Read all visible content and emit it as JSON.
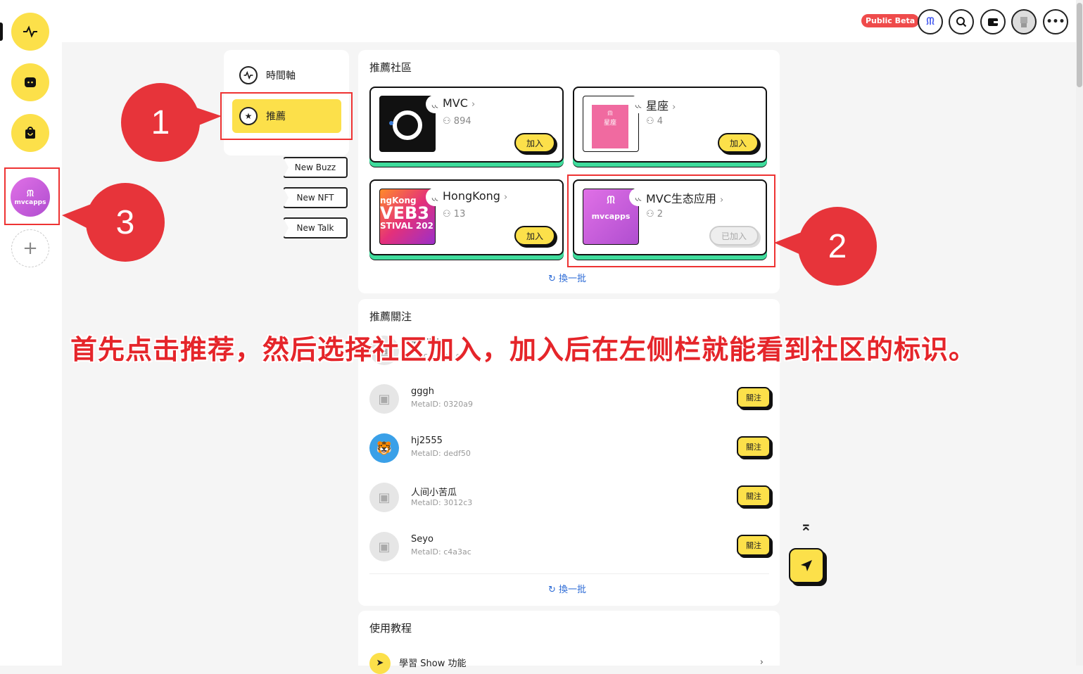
{
  "topbar": {
    "beta_badge": "Public Beta"
  },
  "nav": {
    "timeline_label": "時間軸",
    "recommend_label": "推薦"
  },
  "tags": [
    "New Buzz",
    "New NFT",
    "New Talk"
  ],
  "community_panel": {
    "title": "推薦社區",
    "refresh_label": "換一批",
    "communities": [
      {
        "name": "MVC",
        "members": "894",
        "action": "加入"
      },
      {
        "name": "星座",
        "members": "4",
        "action": "加入"
      },
      {
        "name": "HongKong",
        "members": "13",
        "action": "加入"
      },
      {
        "name": "MVC生态应用",
        "members": "2",
        "action": "已加入"
      }
    ]
  },
  "follow_panel": {
    "title": "推薦關注",
    "refresh_label": "換一批",
    "partial_row": {
      "name": "M''''''''",
      "id": "…ac…: fe…ef"
    },
    "users": [
      {
        "name": "gggh",
        "id": "MetaID: 0320a9",
        "action": "關注"
      },
      {
        "name": "hj2555",
        "id": "MetaID: dedf50",
        "action": "關注"
      },
      {
        "name": "人间小苦瓜",
        "id": "MetaID: 3012c3",
        "action": "關注"
      },
      {
        "name": "Seyo",
        "id": "MetaID: c4a3ac",
        "action": "關注"
      }
    ]
  },
  "tutorial_panel": {
    "title": "使用教程",
    "item": "學習 Show 功能"
  },
  "sidebar_community": {
    "logo_text": "mvcapps"
  },
  "thumb_text": {
    "hongkong_line1": "ngKong",
    "hongkong_line2": "VEB3",
    "hongkong_line3": "STIVAL 202",
    "star_text": "星座",
    "mvcapps": "mvcapps"
  },
  "annotations": {
    "badge_1": "1",
    "badge_2": "2",
    "badge_3": "3",
    "instruction": "首先点击推荐，然后选择社区加入，加入后在左侧栏就能看到社区的标识。"
  },
  "colors": {
    "accent_yellow": "#fce04a",
    "card_shadow_green": "#3fdc9c",
    "annotation_red": "#e7343a"
  }
}
